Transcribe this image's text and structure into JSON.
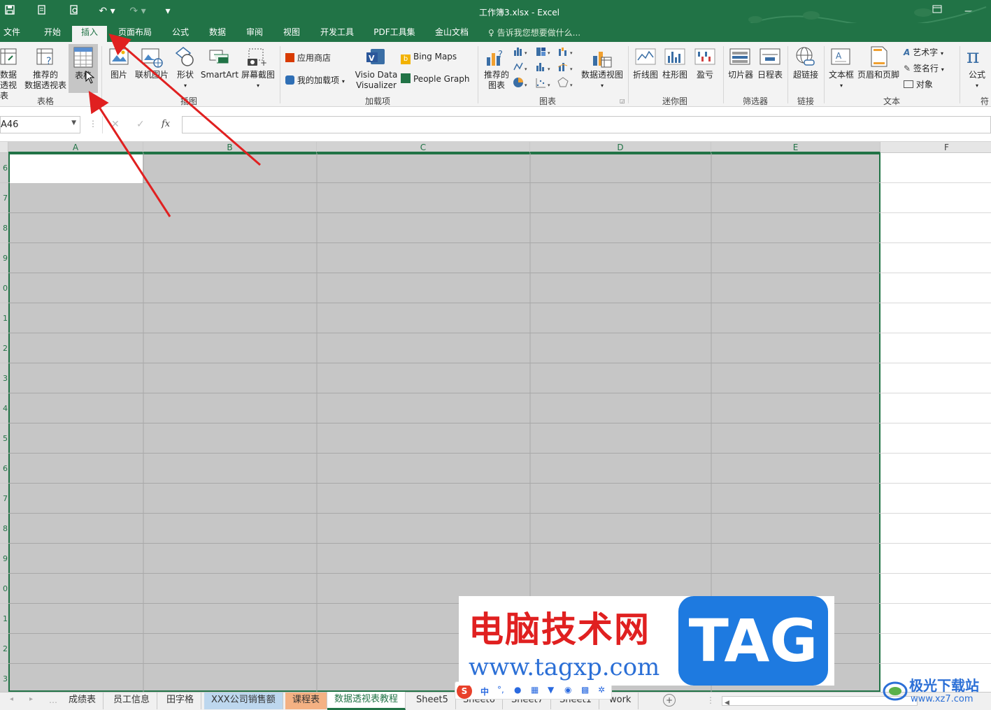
{
  "window": {
    "title": "工作簿3.xlsx - Excel"
  },
  "colors": {
    "excel_green": "#217346",
    "selection_fill": "#c6c6c6",
    "selection_border": "#217346",
    "arrow_red": "#e02020"
  },
  "quick_access": [
    "save-icon",
    "print-preview-icon",
    "print-icon",
    "undo-icon",
    "redo-icon",
    "customize-icon"
  ],
  "tabs": [
    {
      "label": "文件"
    },
    {
      "label": "开始"
    },
    {
      "label": "插入",
      "active": true
    },
    {
      "label": "页面布局"
    },
    {
      "label": "公式"
    },
    {
      "label": "数据"
    },
    {
      "label": "审阅"
    },
    {
      "label": "视图"
    },
    {
      "label": "开发工具"
    },
    {
      "label": "PDF工具集"
    },
    {
      "label": "金山文档"
    }
  ],
  "tell_me": "告诉我您想要做什么...",
  "ribbon": {
    "table_group": {
      "label": "表格",
      "pivot": "数据\n透视表",
      "recommended_pivot": "推荐的\n数据透视表",
      "table": "表格"
    },
    "illustrations_group": {
      "label": "插图",
      "picture": "图片",
      "online_picture": "联机图片",
      "shapes": "形状",
      "smartart": "SmartArt",
      "screenshot": "屏幕截图"
    },
    "addins_group": {
      "label": "加载项",
      "store": "应用商店",
      "my_addins": "我的加载项",
      "visio": "Visio Data\nVisualizer",
      "bing_maps": "Bing Maps",
      "people_graph": "People Graph"
    },
    "charts_group": {
      "label": "图表",
      "recommended_charts": "推荐的\n图表",
      "pivot_chart": "数据透视图"
    },
    "sparklines_group": {
      "label": "迷你图",
      "line": "折线图",
      "column": "柱形图",
      "win_loss": "盈亏"
    },
    "filters_group": {
      "label": "筛选器",
      "slicer": "切片器",
      "timeline": "日程表"
    },
    "links_group": {
      "label": "链接",
      "hyperlink": "超链接"
    },
    "text_group": {
      "label": "文本",
      "textbox": "文本框",
      "header_footer": "页眉和页脚",
      "wordart": "艺术字",
      "signature": "签名行",
      "object": "对象"
    },
    "symbols_group": {
      "label": "符",
      "equation": "公式"
    }
  },
  "formula_bar": {
    "name_box": "A46",
    "fx": "fx",
    "value": ""
  },
  "columns": [
    {
      "label": "A"
    },
    {
      "label": "B"
    },
    {
      "label": "C"
    },
    {
      "label": "D"
    },
    {
      "label": "E"
    },
    {
      "label": "F"
    }
  ],
  "rows": [
    "6",
    "7",
    "8",
    "9",
    "0",
    "1",
    "2",
    "3",
    "4",
    "5",
    "6",
    "7",
    "8",
    "9",
    "0",
    "1",
    "2",
    "3"
  ],
  "sheet_tabs": [
    {
      "label": "成绩表"
    },
    {
      "label": "员工信息"
    },
    {
      "label": "田字格"
    },
    {
      "label": "XXX公司销售额",
      "color": "#bdd7ee"
    },
    {
      "label": "课程表",
      "color": "#f4b183"
    },
    {
      "label": "数据透视表教程",
      "active": true
    },
    {
      "label": "Sheet5"
    },
    {
      "label": "Sheet6"
    },
    {
      "label": "Sheet7"
    },
    {
      "label": "Sheet1"
    },
    {
      "label": "work"
    }
  ],
  "watermark": {
    "cn_text": "电脑技术网",
    "url": "www.tagxp.com",
    "logo": "TAG",
    "corner_brand": "极光下载站",
    "corner_url": "www.xz7.com"
  }
}
